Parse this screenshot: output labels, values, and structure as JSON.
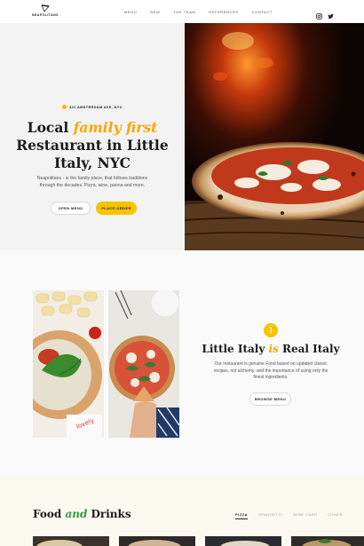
{
  "nav": {
    "logo_text": "NEAPOLITANS",
    "items": [
      {
        "label": "MENU"
      },
      {
        "label": "NEW"
      },
      {
        "label": "THE TEAM"
      },
      {
        "label": "REFERENCES"
      },
      {
        "label": "CONTACT"
      }
    ],
    "social": [
      "instagram-icon",
      "twitter-icon"
    ]
  },
  "hero": {
    "address": "421 AMSTERDAM AVE, NYC",
    "title_prefix": "Local ",
    "title_accent": "family first",
    "title_rest": "Restaurant in Little Italy, NYC",
    "description": "Neapolitans - is the family place, that follows traditions through the decades. Pizza, wine, panna and more.",
    "open_menu": "OPEN MENU",
    "place_order": "PLACE ORDER"
  },
  "about": {
    "title_prefix": "Little Italy ",
    "title_accent": "is",
    "title_suffix": " Real Italy",
    "description": "Our restaurant is genuine Food based on updated classic recipes, not alchemy, and the importance of using only the finest ingredients.",
    "browse": "BROWSE MENU"
  },
  "food": {
    "title_prefix": "Food ",
    "title_accent": "and",
    "title_suffix": " Drinks",
    "tabs": [
      {
        "label": "PIZZA",
        "active": true
      },
      {
        "label": "SPAGHETTI",
        "active": false
      },
      {
        "label": "WINE CARD",
        "active": false
      },
      {
        "label": "OTHER",
        "active": false
      }
    ]
  },
  "colors": {
    "accent": "#f5c400",
    "accent_text": "#f5a800",
    "green": "#2f9a3a"
  }
}
